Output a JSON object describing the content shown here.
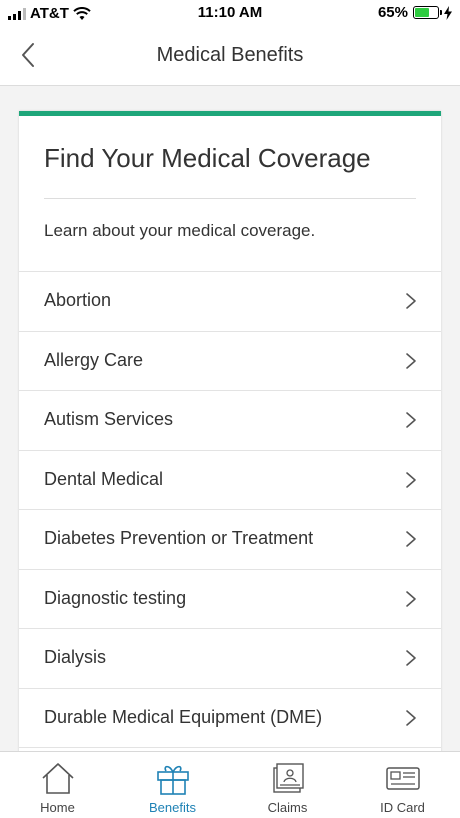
{
  "status_bar": {
    "carrier": "AT&T",
    "time": "11:10 AM",
    "battery": "65%",
    "battery_level": 0.65
  },
  "header": {
    "title": "Medical Benefits",
    "back_icon": "chevron-left-icon"
  },
  "card": {
    "accent_color": "#1ea67a",
    "title": "Find Your Medical Coverage",
    "subtitle": "Learn about your medical coverage.",
    "items": [
      {
        "label": "Abortion"
      },
      {
        "label": "Allergy Care"
      },
      {
        "label": "Autism Services"
      },
      {
        "label": "Dental Medical"
      },
      {
        "label": "Diabetes Prevention or Treatment"
      },
      {
        "label": "Diagnostic testing"
      },
      {
        "label": "Dialysis"
      },
      {
        "label": "Durable Medical Equipment (DME)"
      }
    ]
  },
  "tab_bar": {
    "active_color": "#1f82b5",
    "tabs": [
      {
        "label": "Home",
        "icon": "home-icon",
        "active": false
      },
      {
        "label": "Benefits",
        "icon": "gift-icon",
        "active": true
      },
      {
        "label": "Claims",
        "icon": "claims-icon",
        "active": false
      },
      {
        "label": "ID Card",
        "icon": "id-card-icon",
        "active": false
      }
    ]
  }
}
